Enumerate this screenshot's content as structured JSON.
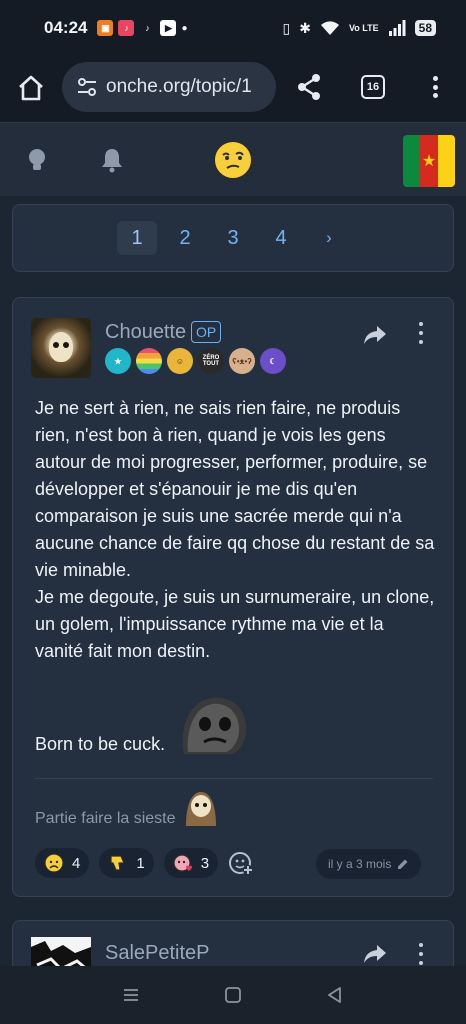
{
  "status_bar": {
    "time": "04:24",
    "network": "Vo LTE",
    "battery": "58"
  },
  "browser": {
    "url": "onche.org/topic/1",
    "tab_count": "16"
  },
  "pagination": {
    "pages": [
      "1",
      "2",
      "3",
      "4"
    ],
    "current": "1",
    "next": "›"
  },
  "post": {
    "author": "Chouette",
    "op_label": "OP",
    "body_paragraphs": [
      "Je ne sert à rien, ne sais rien faire, ne produis rien, n'est bon à rien, quand je vois les gens autour de moi progresser, performer, produire, se développer et s'épanouir je me dis qu'en comparaison je suis une sacrée merde qui n'a aucune chance de faire qq chose du restant de sa vie minable.",
      "Je me degoute, je suis un surnumeraire, un clone, un golem, l'impuissance rythme ma vie et la vanité fait mon destin."
    ],
    "closing": "Born to be cuck.",
    "signature": "Partie faire la sieste",
    "badges": [
      {
        "icon": "star-badge-icon",
        "text": "★",
        "color": "#22b6c9"
      },
      {
        "icon": "rainbow-badge-icon",
        "text": "",
        "color": "#e8506f"
      },
      {
        "icon": "smiley-badge-icon",
        "text": "",
        "color": "#e9b63a"
      },
      {
        "icon": "zero-tout-badge-icon",
        "text": "ZÉRO TOUT",
        "color": "#2a2a2a"
      },
      {
        "icon": "bear-badge-icon",
        "text": "",
        "color": "#d8b08c"
      },
      {
        "icon": "moon-badge-icon",
        "text": "",
        "color": "#6a4fc8"
      }
    ],
    "reactions": [
      {
        "icon": "sad-face-icon",
        "count": "4"
      },
      {
        "icon": "thumbs-down-icon",
        "count": "1"
      },
      {
        "icon": "heart-kiss-icon",
        "count": "3"
      }
    ],
    "timestamp": "il y a 3 mois"
  },
  "next_post": {
    "author": "SalePetiteP"
  },
  "colors": {
    "background": "#1c2532",
    "card": "#243040",
    "link": "#73b3f0",
    "muted": "#9aa9bb"
  }
}
